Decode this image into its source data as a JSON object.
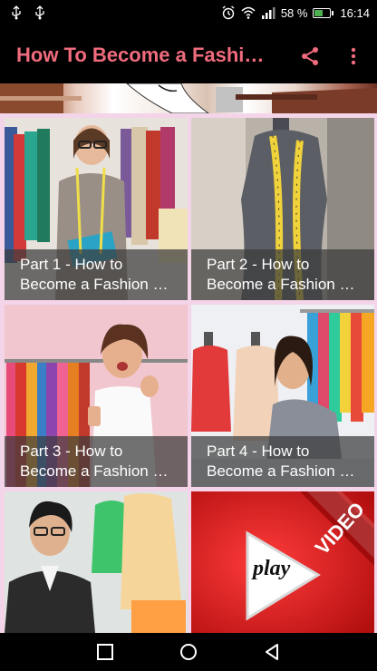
{
  "status_bar": {
    "battery": "58 %",
    "battery_level": 0.58,
    "time": "16:14",
    "icons": [
      "usb-icon",
      "usb-icon",
      "alarm-icon",
      "wifi-icon",
      "signal-icon",
      "battery-icon"
    ]
  },
  "app_bar": {
    "title": "How To Become a Fashion Designer",
    "title_color": "#f06b7d",
    "actions": [
      "share-icon",
      "more-vert-icon"
    ]
  },
  "tiles": [
    {
      "line1": "Part 1 - How to",
      "line2": "Become a Fashion Designer"
    },
    {
      "line1": "Part 2 - How to",
      "line2": "Become a Fashion Designer"
    },
    {
      "line1": "Part 3 - How to",
      "line2": "Become a Fashion Designer"
    },
    {
      "line1": "Part 4 - How to",
      "line2": "Become a Fashion Designer"
    },
    {
      "line1": "",
      "line2": ""
    },
    {
      "badge": "VIDEO",
      "play_label": "play"
    }
  ],
  "colors": {
    "grid_background": "#f4d4e8",
    "video_red": "#e01e1e"
  },
  "nav_bar": {
    "buttons": [
      "recent-apps-icon",
      "home-icon",
      "back-icon"
    ]
  }
}
